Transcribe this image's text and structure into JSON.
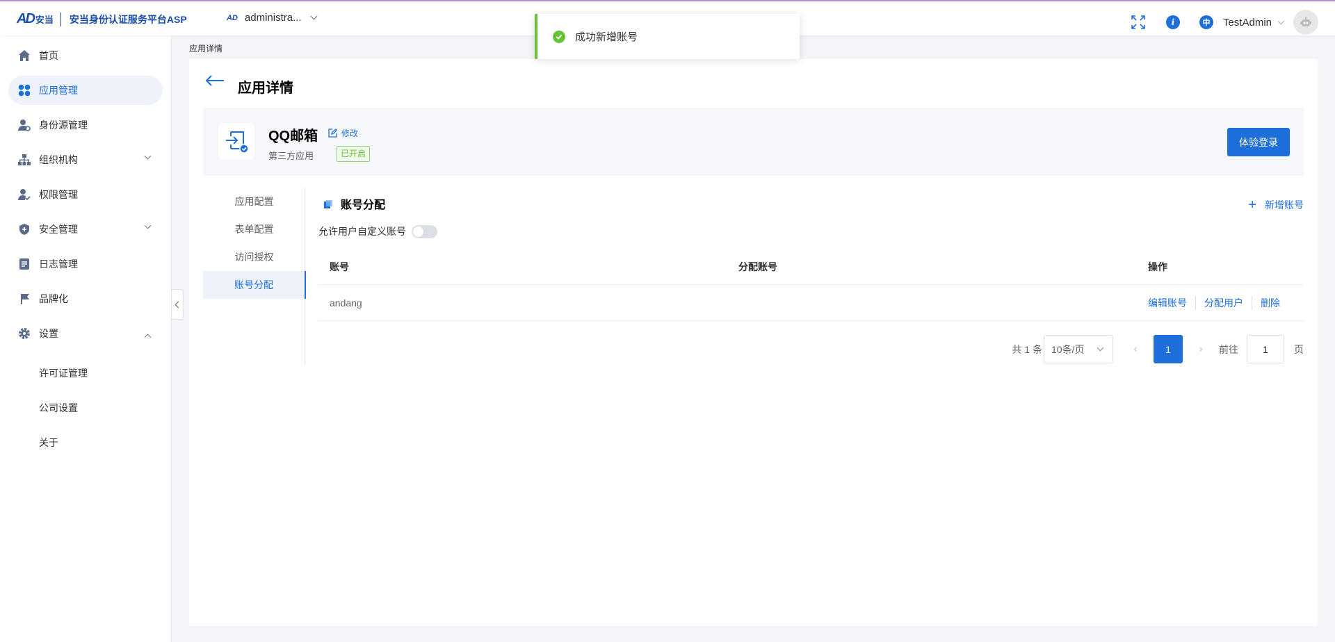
{
  "header": {
    "logo_mark": "AD",
    "logo_cn": "安当",
    "platform_title": "安当身份认证服务平台ASP",
    "tenant_icon": "AD",
    "tenant_name": "administra...",
    "lang_label": "中",
    "info_label": "i",
    "user_name": "TestAdmin"
  },
  "sidebar": {
    "items": [
      {
        "label": "首页",
        "icon": "home-icon"
      },
      {
        "label": "应用管理",
        "icon": "apps-icon",
        "active": true
      },
      {
        "label": "身份源管理",
        "icon": "identity-source-icon"
      },
      {
        "label": "组织机构",
        "icon": "org-tree-icon"
      },
      {
        "label": "权限管理",
        "icon": "permission-icon"
      },
      {
        "label": "安全管理",
        "icon": "shield-icon"
      },
      {
        "label": "日志管理",
        "icon": "log-icon"
      },
      {
        "label": "品牌化",
        "icon": "brand-icon"
      },
      {
        "label": "设置",
        "icon": "gear-icon"
      }
    ],
    "sub_items": [
      "许可证管理",
      "公司设置",
      "关于"
    ]
  },
  "breadcrumb": "应用详情",
  "page": {
    "title": "应用详情",
    "app_name": "QQ邮箱",
    "edit_label": "修改",
    "app_type": "第三方应用",
    "status": "已开启",
    "try_login": "体验登录"
  },
  "tabs": [
    "应用配置",
    "表单配置",
    "访问授权",
    "账号分配"
  ],
  "section": {
    "title": "账号分配",
    "add_label": "新增账号",
    "toggle_label": "允许用户自定义账号",
    "toggle_on": false
  },
  "table": {
    "columns": [
      "账号",
      "分配账号",
      "操作"
    ],
    "rows": [
      {
        "account": "andang",
        "assigned": "",
        "ops": [
          "编辑账号",
          "分配用户",
          "删除"
        ]
      }
    ]
  },
  "pagination": {
    "total": "共 1 条",
    "page_size": "10条/页",
    "prev": "‹",
    "next": "›",
    "current": "1",
    "goto_label": "前往",
    "goto_value": "1",
    "page_unit": "页"
  },
  "toast": {
    "message": "成功新增账号"
  },
  "colors": {
    "primary": "#1e6fd9",
    "success": "#67c23a",
    "brand": "#1a4fa8"
  }
}
